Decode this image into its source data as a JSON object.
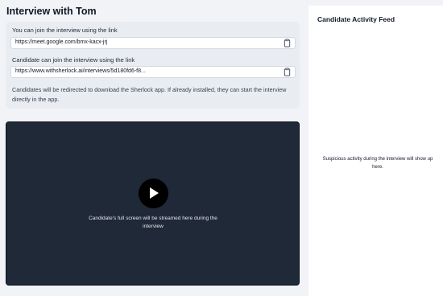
{
  "page": {
    "title": "Interview with Tom"
  },
  "links": {
    "interviewer": {
      "label": "You can join the interview using the link",
      "value": "https://meet.google.com/bmx-kacx-jrj"
    },
    "candidate": {
      "label": "Candidate can join the interview using the link",
      "value": "https://www.withsherlock.ai/interviews/5d180fd6-f8..."
    },
    "note": "Candidates will be redirected to download the Sherlock app. If already installed, they can start the interview directly in the app."
  },
  "video": {
    "caption": "Candidate's full screen will be streamed here during the interview"
  },
  "feed": {
    "title": "Candidate Activity Feed",
    "empty_message": "Suspicious activity during the interview will show up here."
  },
  "icons": {
    "copy": "clipboard-icon",
    "play": "play-icon"
  },
  "colors": {
    "video_bg": "#1f2937",
    "card_bg": "#e9ecf1",
    "page_bg": "#f1f3f6"
  }
}
